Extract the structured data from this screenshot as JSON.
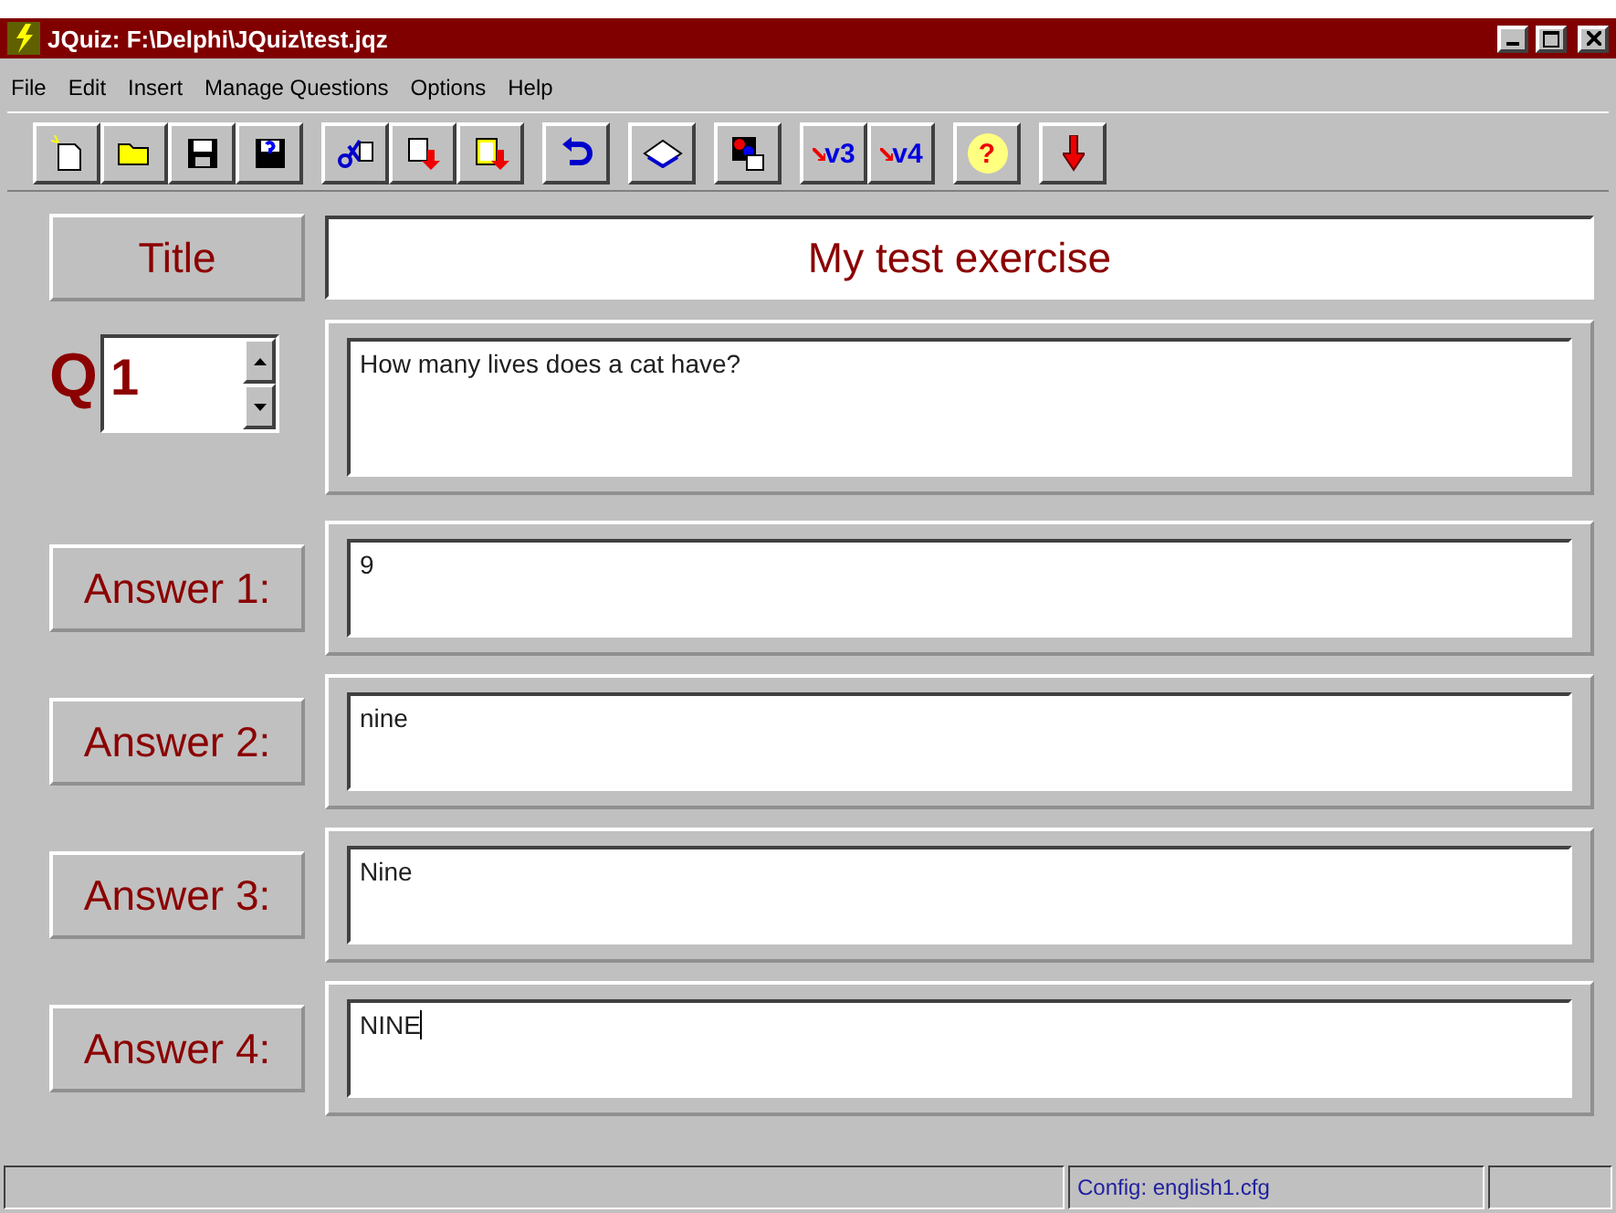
{
  "window": {
    "title": "JQuiz: F:\\Delphi\\JQuiz\\test.jqz"
  },
  "menu": [
    "File",
    "Edit",
    "Insert",
    "Manage Questions",
    "Options",
    "Help"
  ],
  "toolbar": [
    [
      {
        "kind": "new"
      },
      {
        "kind": "open"
      },
      {
        "kind": "save"
      },
      {
        "kind": "saveas"
      }
    ],
    [
      {
        "kind": "scissors"
      },
      {
        "kind": "copy"
      },
      {
        "kind": "paste"
      }
    ],
    [
      {
        "kind": "undo"
      }
    ],
    [
      {
        "kind": "book"
      }
    ],
    [
      {
        "kind": "shapes"
      }
    ],
    [
      {
        "kind": "version",
        "label": "v3"
      },
      {
        "kind": "version",
        "label": "v4"
      }
    ],
    [
      {
        "kind": "help",
        "label": "?"
      }
    ],
    [
      {
        "kind": "down"
      }
    ]
  ],
  "title": {
    "label": "Title",
    "value": "My test exercise"
  },
  "question": {
    "letter": "Q",
    "number": "1",
    "text": "How many lives does a cat have?"
  },
  "answers": [
    {
      "label": "Answer 1:",
      "value": "9",
      "focused": false
    },
    {
      "label": "Answer 2:",
      "value": "nine",
      "focused": false
    },
    {
      "label": "Answer 3:",
      "value": "Nine",
      "focused": false
    },
    {
      "label": "Answer 4:",
      "value": "NINE",
      "focused": true
    }
  ],
  "status_bar": {
    "config": "Config: english1.cfg"
  }
}
